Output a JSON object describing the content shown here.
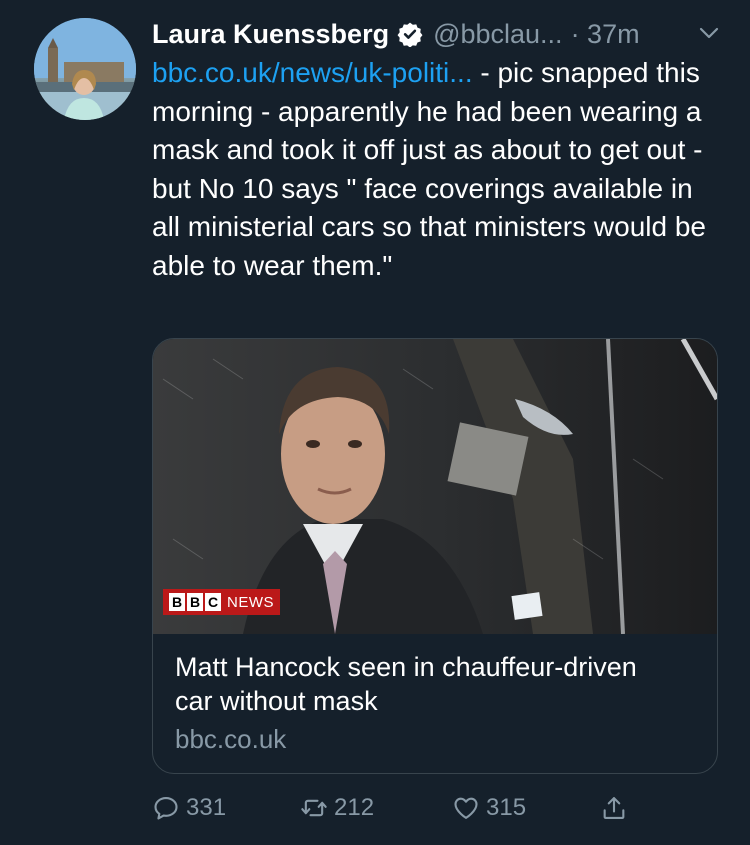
{
  "tweet": {
    "author_name": "Laura Kuenssberg",
    "handle": "@bbclau...",
    "time": "· 37m",
    "link_text": "bbc.co.uk/news/uk-politi...",
    "body": " - pic snapped this morning - apparently he had been wearing a mask and took it off just as about to get out - but No 10 says \" face coverings available in all ministerial cars so that ministers would be able to wear them.\""
  },
  "card": {
    "badge_box_letters": [
      "B",
      "B",
      "C"
    ],
    "badge_news": "NEWS",
    "title": "Matt Hancock seen in chauffeur-driven car without mask",
    "domain": "bbc.co.uk"
  },
  "actions": {
    "replies": "331",
    "retweets": "212",
    "likes": "315"
  },
  "colors": {
    "background": "#15202b",
    "link": "#1da1f2",
    "secondary_text": "#8899a6",
    "bbc_red": "#bb1919"
  },
  "icons": [
    "verified-icon",
    "chevron-down-icon",
    "reply-icon",
    "retweet-icon",
    "like-icon",
    "share-icon"
  ]
}
